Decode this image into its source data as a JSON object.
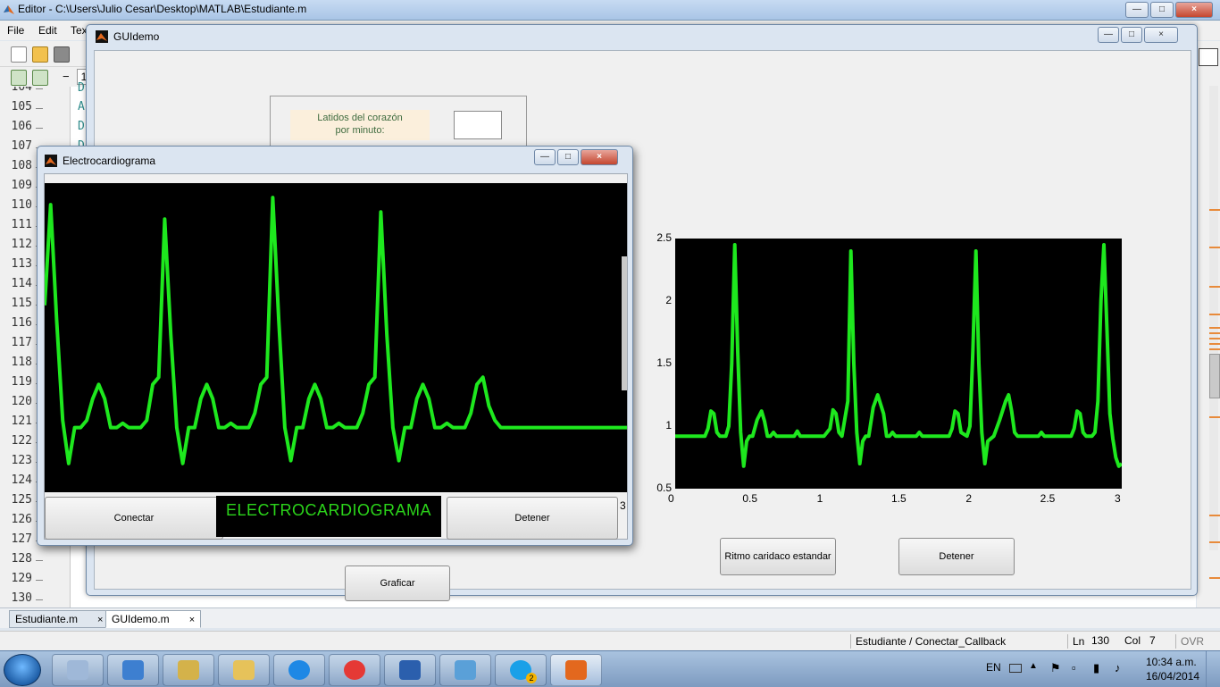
{
  "editor": {
    "title": "Editor - C:\\Users\\Julio Cesar\\Desktop\\MATLAB\\Estudiante.m",
    "menu": [
      "File",
      "Edit",
      "Tex"
    ],
    "line_numbers": [
      "104",
      "105",
      "106",
      "107",
      "108",
      "109",
      "110",
      "111",
      "112",
      "113",
      "114",
      "115",
      "116",
      "117",
      "118",
      "119",
      "120",
      "121",
      "122",
      "123",
      "124",
      "125",
      "126",
      "127",
      "128",
      "129",
      "130"
    ],
    "code_fragments": [
      "D",
      "A",
      "D",
      "D"
    ],
    "toolbar_field": "1",
    "tabs": [
      {
        "label": "Estudiante.m",
        "close": "×"
      },
      {
        "label": "GUIdemo.m",
        "close": "×"
      }
    ],
    "status": {
      "function": "Estudiante / Conectar_Callback",
      "ln_label": "Ln",
      "ln_value": "130",
      "col_label": "Col",
      "col_value": "7",
      "ovr": "OVR"
    }
  },
  "guidemo": {
    "title": "GUIdemo",
    "bpm_label_line1": "Latidos del corazón",
    "bpm_label_line2": "por minuto:",
    "bpm_value": "",
    "buttons": {
      "graficar": "Graficar",
      "ritmo": "Ritmo caridaco estandar",
      "detener": "Detener"
    }
  },
  "ecg_window": {
    "title": "Electrocardiograma",
    "banner": "ELECTROCARDIOGRAMA",
    "buttons": {
      "conectar": "Conectar",
      "detener": "Detener"
    },
    "partial_text": "3"
  },
  "taskbar": {
    "language": "EN",
    "time": "10:34 a.m.",
    "date": "16/04/2014",
    "skype_badge": "2",
    "apps": [
      "calculator-icon",
      "media-player-icon",
      "tools-icon",
      "file-explorer-icon",
      "internet-explorer-icon",
      "chrome-icon",
      "word-icon",
      "virtualbox-icon",
      "skype-icon",
      "matlab-icon"
    ]
  },
  "colors": {
    "ecg_green": "#1ee81e",
    "plot_background": "#000000",
    "banner_text": "#2bd41a"
  },
  "chart_data": [
    {
      "type": "line",
      "title": "",
      "xlabel": "",
      "ylabel": "",
      "xlim": [
        0,
        3
      ],
      "ylim": [
        0.5,
        2.5
      ],
      "x_ticks": [
        "0",
        "0.5",
        "1",
        "1.5",
        "2",
        "2.5",
        "3"
      ],
      "y_ticks": [
        "0.5",
        "1",
        "1.5",
        "2",
        "2.5"
      ],
      "grid": false,
      "series": [
        {
          "x": [
            0,
            0.2,
            0.22,
            0.24,
            0.26,
            0.28,
            0.3,
            0.34,
            0.36,
            0.38,
            0.4,
            0.42,
            0.44,
            0.46,
            0.48,
            0.5,
            0.52,
            0.55,
            0.58,
            0.6,
            0.62,
            0.64,
            0.66,
            0.68,
            0.72,
            0.8,
            0.82,
            0.84,
            0.86,
            0.9,
            1.0,
            1.04,
            1.06,
            1.08,
            1.1,
            1.12,
            1.16,
            1.18,
            1.2,
            1.22,
            1.24,
            1.26,
            1.28,
            1.3,
            1.33,
            1.36,
            1.4,
            1.42,
            1.44,
            1.46,
            1.48,
            1.5,
            1.54,
            1.62,
            1.64,
            1.66,
            1.68,
            1.72,
            1.84,
            1.86,
            1.88,
            1.9,
            1.92,
            1.96,
            1.98,
            2.0,
            2.02,
            2.04,
            2.06,
            2.08,
            2.1,
            2.14,
            2.18,
            2.22,
            2.24,
            2.26,
            2.28,
            2.3,
            2.34,
            2.44,
            2.46,
            2.48,
            2.5,
            2.54,
            2.66,
            2.68,
            2.7,
            2.72,
            2.74,
            2.76,
            2.8,
            2.82,
            2.84,
            2.86,
            2.88,
            2.9,
            2.92,
            2.94,
            2.96,
            2.98,
            3.0
          ],
          "y": [
            0.92,
            0.92,
            0.98,
            1.12,
            1.1,
            0.95,
            0.92,
            0.92,
            1.0,
            1.5,
            2.45,
            1.6,
            0.95,
            0.68,
            0.88,
            0.92,
            0.92,
            1.05,
            1.12,
            1.04,
            0.92,
            0.92,
            0.95,
            0.92,
            0.92,
            0.92,
            0.96,
            0.92,
            0.92,
            0.92,
            0.92,
            0.98,
            1.13,
            1.1,
            0.95,
            0.92,
            1.2,
            2.4,
            1.5,
            0.95,
            0.7,
            0.88,
            0.92,
            0.92,
            1.15,
            1.25,
            1.1,
            0.92,
            0.92,
            0.95,
            0.92,
            0.92,
            0.92,
            0.92,
            0.95,
            0.92,
            0.92,
            0.92,
            0.92,
            0.98,
            1.12,
            1.1,
            0.95,
            0.92,
            1.0,
            1.6,
            2.4,
            1.5,
            0.95,
            0.7,
            0.88,
            0.92,
            1.05,
            1.2,
            1.25,
            1.12,
            0.95,
            0.92,
            0.92,
            0.92,
            0.95,
            0.92,
            0.92,
            0.92,
            0.92,
            0.98,
            1.12,
            1.1,
            0.95,
            0.92,
            0.92,
            0.95,
            1.2,
            2.0,
            2.45,
            1.8,
            1.1,
            0.9,
            0.75,
            0.68,
            0.7
          ]
        }
      ]
    },
    {
      "type": "line",
      "title": "",
      "xlabel": "",
      "ylabel": "",
      "grid": false,
      "series": [
        {
          "x": [
            0,
            1,
            2,
            3,
            4,
            5,
            6,
            7,
            8,
            9,
            10,
            11,
            12,
            13,
            14,
            15,
            16,
            17,
            18,
            19,
            20,
            21,
            22,
            23,
            24,
            25,
            26,
            27,
            28,
            29,
            30,
            31,
            32,
            33,
            34,
            35,
            36,
            37,
            38,
            39,
            40,
            41,
            42,
            43,
            44,
            45,
            46,
            47,
            48,
            49,
            50,
            51,
            52,
            53,
            54,
            55,
            56,
            57,
            58,
            59,
            60,
            61,
            62,
            63,
            64,
            65,
            66,
            67,
            68,
            69,
            70,
            71,
            72,
            73,
            74,
            75,
            76,
            77,
            78,
            79,
            80,
            81,
            82,
            83,
            84,
            85,
            86,
            87,
            88,
            89,
            90,
            91,
            92,
            93,
            94,
            95,
            96,
            97
          ],
          "y": [
            1.7,
            2.4,
            1.6,
            0.9,
            0.6,
            0.85,
            0.85,
            0.9,
            1.05,
            1.15,
            1.05,
            0.85,
            0.85,
            0.88,
            0.85,
            0.85,
            0.85,
            0.9,
            1.15,
            1.2,
            2.3,
            1.5,
            0.85,
            0.6,
            0.85,
            0.85,
            1.05,
            1.15,
            1.05,
            0.85,
            0.85,
            0.88,
            0.85,
            0.85,
            0.85,
            0.95,
            1.15,
            1.2,
            2.45,
            1.6,
            0.85,
            0.62,
            0.85,
            0.85,
            1.05,
            1.15,
            1.05,
            0.85,
            0.85,
            0.88,
            0.85,
            0.85,
            0.85,
            0.95,
            1.15,
            1.2,
            2.35,
            1.5,
            0.85,
            0.62,
            0.85,
            0.85,
            1.05,
            1.15,
            1.05,
            0.85,
            0.85,
            0.88,
            0.85,
            0.85,
            0.85,
            0.95,
            1.15,
            1.2,
            1.0,
            0.9,
            0.85,
            0.85,
            0.85,
            0.85,
            0.85,
            0.85,
            0.85,
            0.85,
            0.85,
            0.85,
            0.85,
            0.85,
            0.85,
            0.85,
            0.85,
            0.85,
            0.85,
            0.85,
            0.85,
            0.85,
            0.85,
            0.85
          ]
        }
      ]
    }
  ]
}
